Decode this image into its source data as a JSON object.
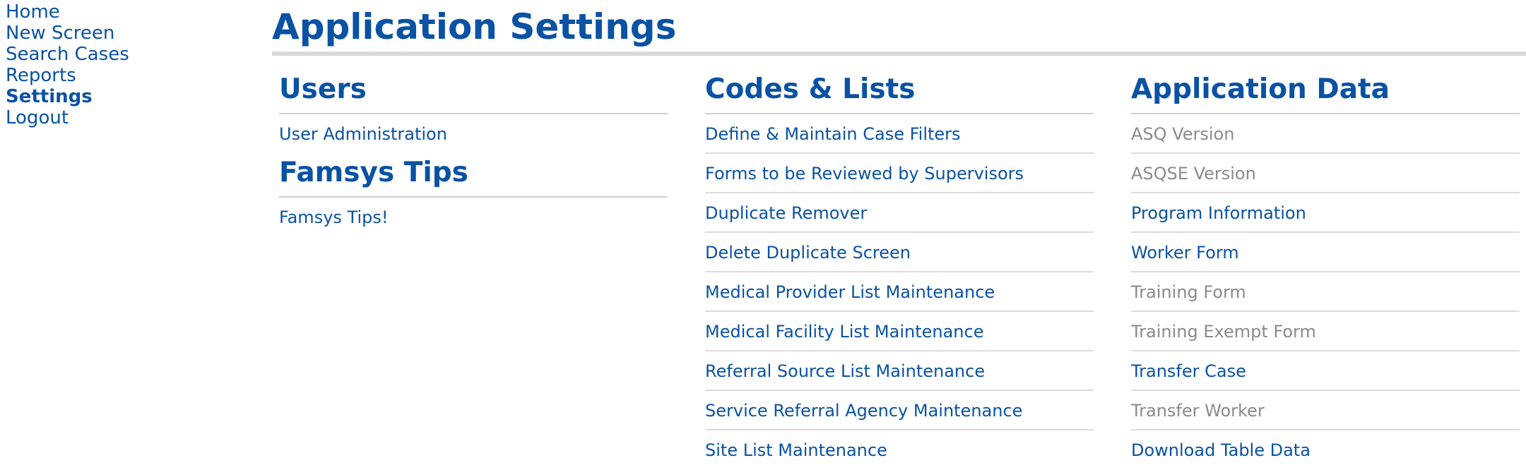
{
  "nav": {
    "items": [
      {
        "label": "Home",
        "active": false
      },
      {
        "label": "New Screen",
        "active": false
      },
      {
        "label": "Search Cases",
        "active": false
      },
      {
        "label": "Reports",
        "active": false
      },
      {
        "label": "Settings",
        "active": true
      },
      {
        "label": "Logout",
        "active": false
      }
    ]
  },
  "page": {
    "title": "Application Settings"
  },
  "colors": {
    "link": "#0a52a3",
    "disabled": "#8a8a8a",
    "rule": "#d9d9d9"
  },
  "sections": {
    "users": {
      "heading": "Users",
      "items": [
        {
          "label": "User Administration",
          "enabled": true
        }
      ]
    },
    "famsys_tips": {
      "heading": "Famsys Tips",
      "items": [
        {
          "label": "Famsys Tips!",
          "enabled": true
        }
      ]
    },
    "codes_lists": {
      "heading": "Codes & Lists",
      "items": [
        {
          "label": "Define & Maintain Case Filters",
          "enabled": true
        },
        {
          "label": "Forms to be Reviewed by Supervisors",
          "enabled": true
        },
        {
          "label": "Duplicate Remover",
          "enabled": true
        },
        {
          "label": "Delete Duplicate Screen",
          "enabled": true
        },
        {
          "label": "Medical Provider List Maintenance",
          "enabled": true
        },
        {
          "label": "Medical Facility List Maintenance",
          "enabled": true
        },
        {
          "label": "Referral Source List Maintenance",
          "enabled": true
        },
        {
          "label": "Service Referral Agency Maintenance",
          "enabled": true
        },
        {
          "label": "Site List Maintenance",
          "enabled": true
        }
      ]
    },
    "application_data": {
      "heading": "Application Data",
      "items": [
        {
          "label": "ASQ Version",
          "enabled": false
        },
        {
          "label": "ASQSE Version",
          "enabled": false
        },
        {
          "label": "Program Information",
          "enabled": true
        },
        {
          "label": "Worker Form",
          "enabled": true
        },
        {
          "label": "Training Form",
          "enabled": false
        },
        {
          "label": "Training Exempt Form",
          "enabled": false
        },
        {
          "label": "Transfer Case",
          "enabled": true
        },
        {
          "label": "Transfer Worker",
          "enabled": false
        },
        {
          "label": "Download Table Data",
          "enabled": true
        }
      ]
    }
  }
}
